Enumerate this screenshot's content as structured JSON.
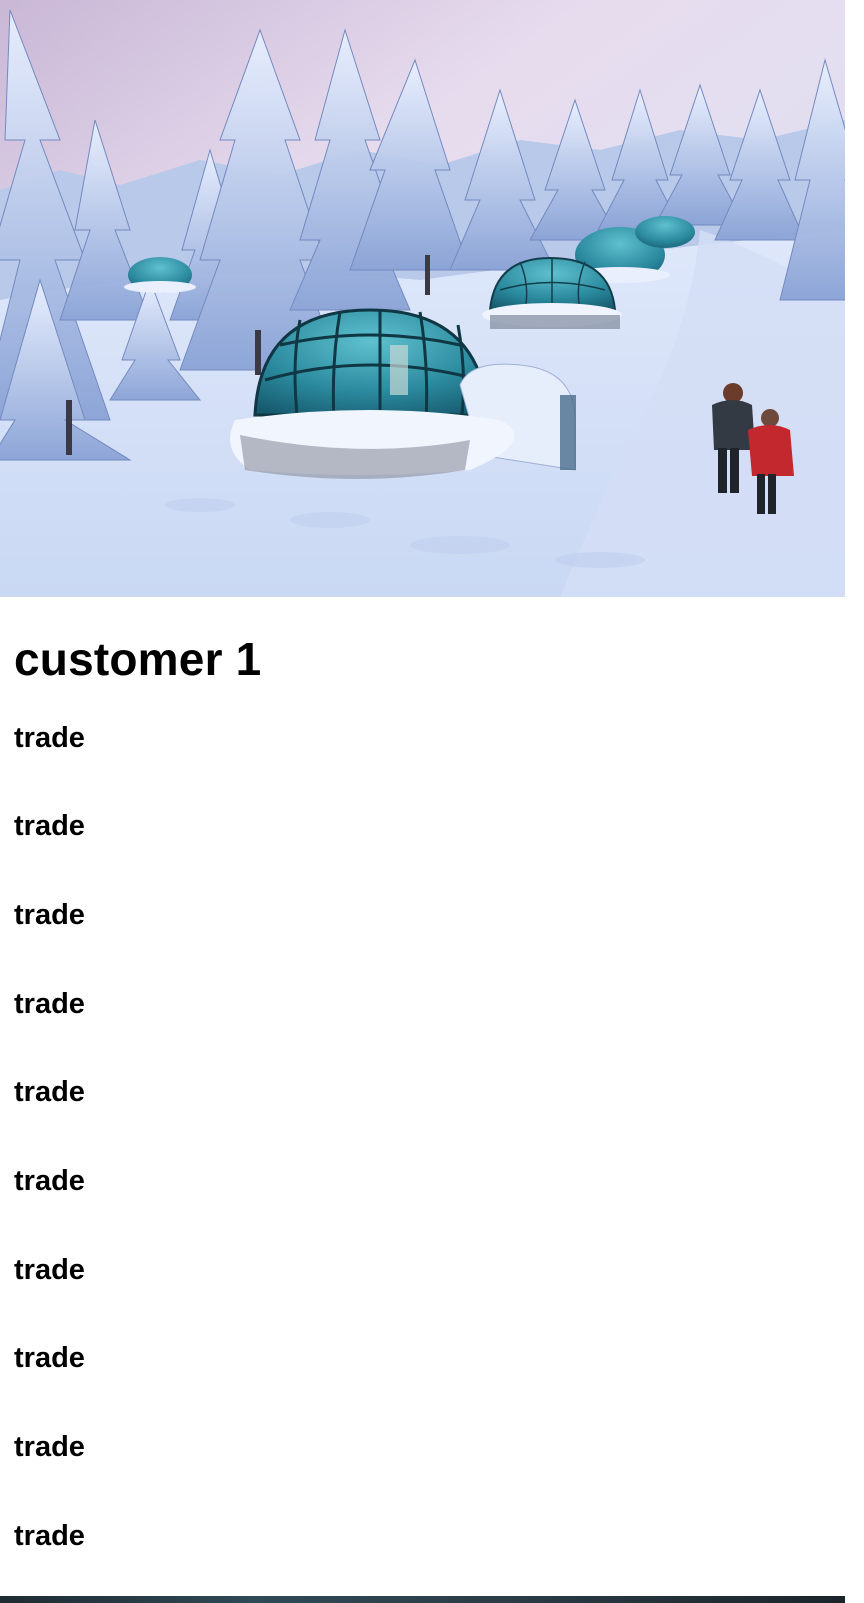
{
  "title": "customer 1",
  "items": [
    {
      "label": "trade"
    },
    {
      "label": "trade"
    },
    {
      "label": "trade"
    },
    {
      "label": "trade"
    },
    {
      "label": "trade"
    },
    {
      "label": "trade"
    },
    {
      "label": "trade"
    },
    {
      "label": "trade"
    },
    {
      "label": "trade"
    },
    {
      "label": "trade"
    }
  ],
  "colors": {
    "background": "#ffffff",
    "text": "#000000",
    "snow": "#e6eefb",
    "sky": "#dfe3f3",
    "glass": "#2e8da0"
  }
}
